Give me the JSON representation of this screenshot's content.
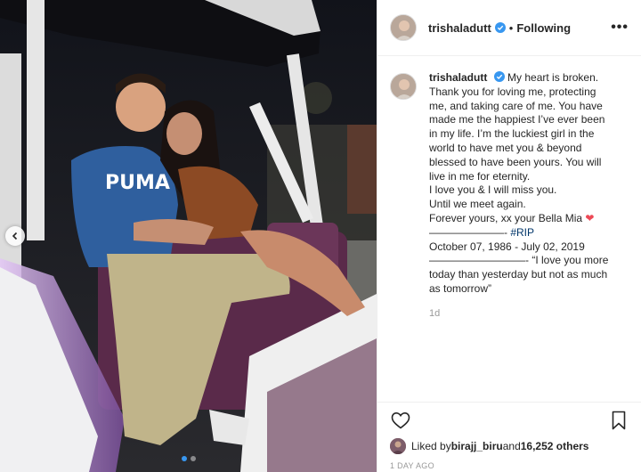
{
  "post": {
    "username": "trishaladutt",
    "following_label": "Following",
    "separator": "•",
    "more_label": "•••",
    "caption_lines": [
      "My heart is broken.",
      "Thank you for loving me, protecting",
      "me, and taking care of me. You have",
      "made me the happiest I’ve ever been",
      "in my life. I’m the luckiest girl in the",
      "world to have met you & beyond",
      "blessed to have been yours. You will",
      "live in me for eternity.",
      "I love you & I will miss you.",
      "Until we meet again.",
      "Forever yours, xx your Bella Mia"
    ],
    "heart_emoji": "❤",
    "rip_prefix": "———————- ",
    "hashtag": "#RIP",
    "dates_line": "October 07, 1986 - July 02, 2019",
    "quote_prefix": "—————————- ",
    "quote_lines": [
      "“I love you more",
      "today than yesterday but not as much",
      "as tomorrow”"
    ],
    "comment_time": "1d",
    "likes": {
      "prefix": "Liked by ",
      "user": "birajj_biru",
      "middle": " and ",
      "count": "16,252 others"
    },
    "posted_ago": "1 DAY AGO"
  },
  "carousel": {
    "total": 2,
    "current": 1
  },
  "colors": {
    "verified": "#3897f0",
    "hashtag": "#003569",
    "heart": "#ed4956",
    "meta": "#999999"
  },
  "icons": [
    "chevron-left-icon",
    "verified-icon",
    "more-icon",
    "heart-outline-icon",
    "bookmark-icon"
  ]
}
